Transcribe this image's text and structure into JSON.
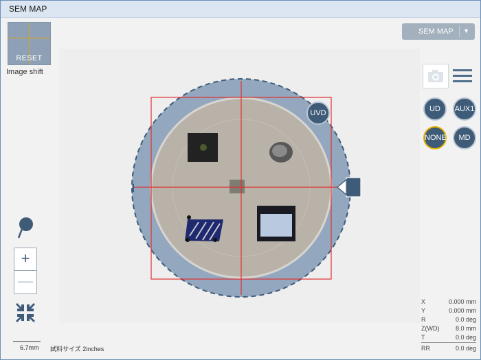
{
  "window": {
    "title": "SEM MAP"
  },
  "image_shift": {
    "reset_label": "RESET",
    "caption": "Image shift"
  },
  "mode_dropdown": {
    "label": "SEM MAP"
  },
  "detectors": {
    "uvd": "UVD",
    "ud": "UD",
    "aux1": "AUX1",
    "none": "NONE",
    "md": "MD",
    "active": "NONE"
  },
  "scale": {
    "value": "6.7mm",
    "sample_size": "試料サイズ 2inches"
  },
  "readouts": [
    {
      "label": "X",
      "value": "0.000 mm"
    },
    {
      "label": "Y",
      "value": "0.000 mm"
    },
    {
      "label": "R",
      "value": "0.0 deg"
    },
    {
      "label": "Z(WD)",
      "value": "8.0 mm"
    },
    {
      "label": "T",
      "value": "0.0 deg"
    },
    {
      "label": "RR",
      "value": "0.0 deg"
    }
  ],
  "icons": {
    "camera": "camera-icon",
    "menu": "hamburger-menu-icon",
    "pin": "map-pin-icon",
    "zoom_in": "plus-icon",
    "zoom_out": "minus-icon",
    "fit": "collapse-arrows-icon",
    "stage_handle": "stage-handle-icon"
  },
  "colors": {
    "accent": "#3e5b78",
    "highlight": "#e8b200",
    "frame": "#e03030",
    "stage_ring": "#93a8be"
  }
}
